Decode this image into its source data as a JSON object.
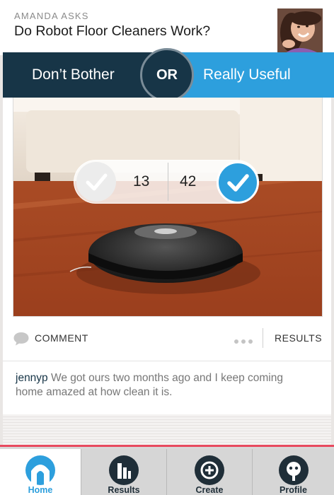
{
  "question": {
    "asker": "AMANDA ASKS",
    "title": "Do Robot Floor Cleaners Work?"
  },
  "choices": {
    "left_label": "Don’t Bother",
    "or_label": "OR",
    "right_label": "Really Useful"
  },
  "votes": {
    "left_count": "13",
    "right_count": "42",
    "selected": "right"
  },
  "actions": {
    "comment_label": "COMMENT",
    "results_label": "RESULTS"
  },
  "comment": {
    "user": "jennyp",
    "text": " We got ours two months ago and I keep coming home amazed at how clean it is."
  },
  "tabbar": {
    "active": "Home",
    "tabs": [
      {
        "label": "Home",
        "icon": "home-icon"
      },
      {
        "label": "Results",
        "icon": "results-icon"
      },
      {
        "label": "Create",
        "icon": "create-icon"
      },
      {
        "label": "Profile",
        "icon": "profile-icon"
      }
    ]
  },
  "colors": {
    "dark_navy": "#173547",
    "accent_blue": "#2d9fdd",
    "tab_accent_red": "#e84a5f"
  }
}
